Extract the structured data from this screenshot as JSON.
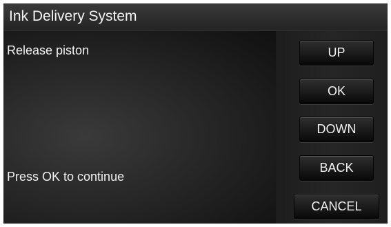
{
  "header": {
    "title": "Ink Delivery System"
  },
  "messages": {
    "instruction": "Release piston",
    "prompt": "Press OK to continue"
  },
  "buttons": {
    "up": "UP",
    "ok": "OK",
    "down": "DOWN",
    "back": "BACK",
    "cancel": "CANCEL"
  }
}
